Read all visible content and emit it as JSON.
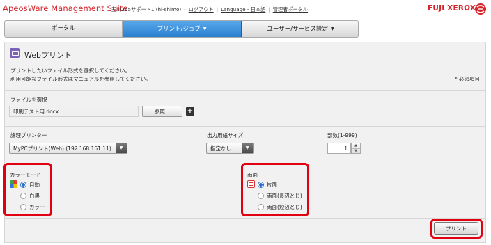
{
  "header": {
    "app_title": "ApeosWare Management Suite",
    "user": "玉川365サポート1 (hi-shimo)",
    "logout": "ログアウト",
    "language": "Language - 日本語",
    "admin_portal": "管理者ポータル",
    "brand": "FUJI XEROX"
  },
  "nav": {
    "tabs": [
      {
        "label": "ポータル",
        "active": false
      },
      {
        "label": "プリント/ジョブ",
        "active": true
      },
      {
        "label": "ユーザー/サービス設定",
        "active": false
      }
    ],
    "caret": "▼"
  },
  "page": {
    "title": "Webプリント",
    "desc1": "プリントしたいファイル形式を選択してください。",
    "desc2": "利用可能なファイル形式はマニュアルを参照してください。",
    "required_note": "* 必須項目"
  },
  "file": {
    "label": "ファイルを選択",
    "value": "印刷テスト用.docx",
    "browse_label": "参照...",
    "add_label": "+"
  },
  "options": {
    "printer_label": "論理プリンター",
    "printer_value": "MyPCプリント(Web) (192.168.161.11)",
    "paper_label": "出力用紙サイズ",
    "paper_value": "指定なし",
    "copies_label": "部数(1-999)",
    "copies_value": "1",
    "arrow": "▼",
    "spin_up": "▲",
    "spin_down": "▼"
  },
  "color_mode": {
    "label": "カラーモード",
    "options": [
      {
        "label": "自動",
        "selected": true
      },
      {
        "label": "白黒",
        "selected": false
      },
      {
        "label": "カラー",
        "selected": false
      }
    ]
  },
  "duplex": {
    "label": "両面",
    "options": [
      {
        "label": "片面",
        "selected": true
      },
      {
        "label": "両面(長辺とじ)",
        "selected": false
      },
      {
        "label": "両面(短辺とじ)",
        "selected": false
      }
    ]
  },
  "print_button": "プリント",
  "colors": {
    "brand_red": "#d2232a",
    "highlight_red": "#e00012",
    "active_tab_blue": "#3a8de0"
  }
}
